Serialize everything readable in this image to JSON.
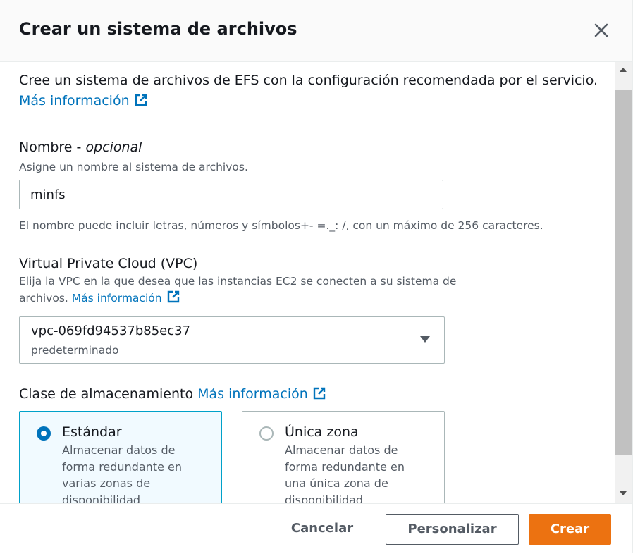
{
  "dialog": {
    "title": "Crear un sistema de archivos",
    "description": "Cree un sistema de archivos de EFS con la configuración recomendada por el servicio.",
    "learn_more": "Más información"
  },
  "name_field": {
    "label": "Nombre - ",
    "label_optional": "opcional",
    "description": "Asigne un nombre al sistema de archivos.",
    "value": "minfs",
    "constraint": "El nombre puede incluir letras, números y símbolos+- =._: /, con un máximo de 256 caracteres."
  },
  "vpc_field": {
    "label": "Virtual Private Cloud (VPC)",
    "description": "Elija la VPC en la que desea que las instancias EC2 se conecten a su sistema de",
    "description_line2": "archivos.",
    "learn_more": "Más información",
    "selected_value": "vpc-069fd94537b85ec37",
    "selected_tag": "predeterminado"
  },
  "storage_class": {
    "label": "Clase de almacenamiento",
    "learn_more": "Más información",
    "options": [
      {
        "name": "Estándar",
        "description": "Almacenar datos de forma redundante en varias zonas de disponibilidad",
        "selected": true
      },
      {
        "name": "Única zona",
        "description": "Almacenar datos de forma redundante en una única zona de disponibilidad",
        "selected": false
      }
    ]
  },
  "footer": {
    "cancel": "Cancelar",
    "customize": "Personalizar",
    "create": "Crear"
  },
  "icons": {
    "close": "close-icon",
    "external": "external-link-icon",
    "caret": "caret-down-icon"
  },
  "colors": {
    "link": "#0073bb",
    "primary_button": "#ec7211",
    "selected_border": "#00a1c9",
    "selected_bg": "#f1faff"
  }
}
